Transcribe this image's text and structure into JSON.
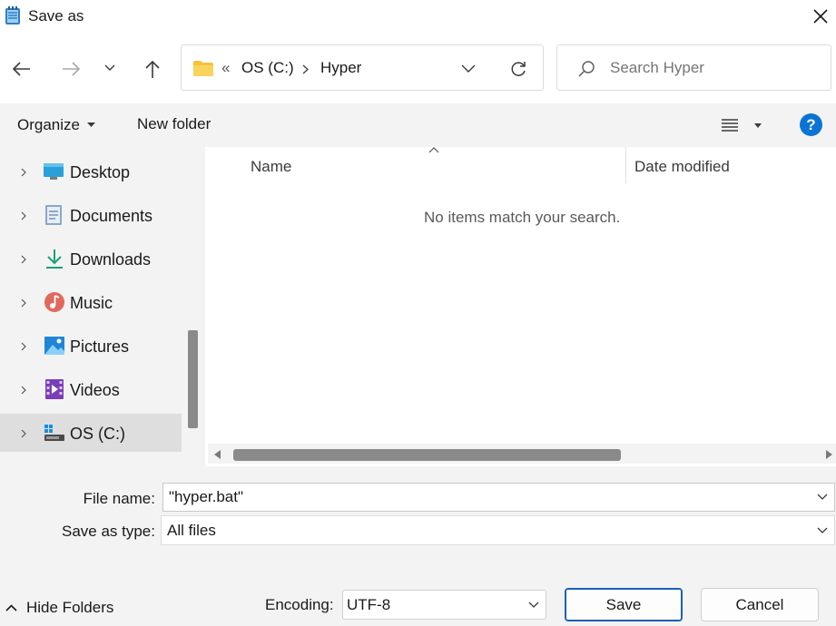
{
  "window": {
    "title": "Save as",
    "icon": "notepad-icon"
  },
  "address": {
    "overflow": "«",
    "crumbs": [
      "OS (C:)",
      "Hyper"
    ]
  },
  "search": {
    "placeholder": "Search Hyper"
  },
  "toolbar": {
    "organize": "Organize",
    "new_folder": "New folder",
    "help": "?"
  },
  "sidebar": {
    "items": [
      {
        "label": "Desktop",
        "icon": "desktop-icon"
      },
      {
        "label": "Documents",
        "icon": "documents-icon"
      },
      {
        "label": "Downloads",
        "icon": "downloads-icon"
      },
      {
        "label": "Music",
        "icon": "music-icon"
      },
      {
        "label": "Pictures",
        "icon": "pictures-icon"
      },
      {
        "label": "Videos",
        "icon": "videos-icon"
      },
      {
        "label": "OS (C:)",
        "icon": "drive-icon",
        "selected": true
      }
    ]
  },
  "content": {
    "columns": [
      "Name",
      "Date modified"
    ],
    "empty_message": "No items match your search."
  },
  "form": {
    "file_name_label": "File name:",
    "file_name_value": "\"hyper.bat\"",
    "save_type_label": "Save as type:",
    "save_type_value": "All files",
    "encoding_label": "Encoding:",
    "encoding_value": "UTF-8"
  },
  "footer": {
    "hide_folders": "Hide Folders",
    "save": "Save",
    "cancel": "Cancel"
  },
  "colors": {
    "accent": "#1a5fb4",
    "help_blue": "#0a74d4",
    "folder_yellow": "#f4c338"
  }
}
